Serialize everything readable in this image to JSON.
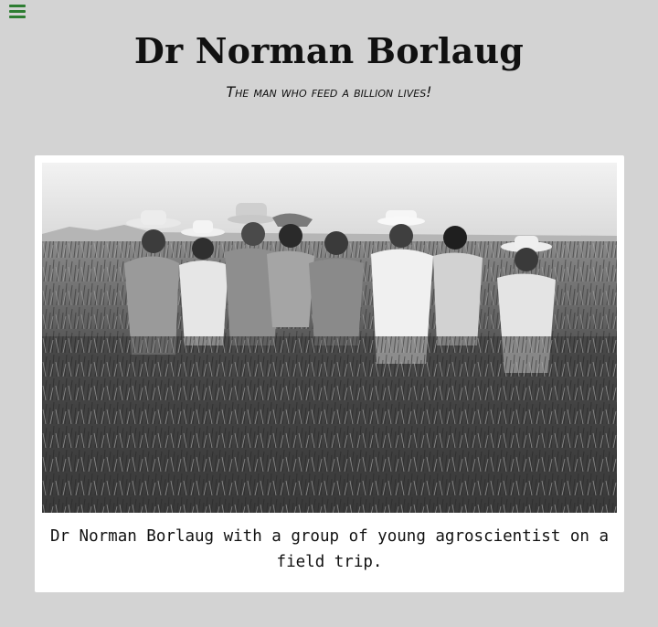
{
  "header": {
    "title": "Dr Norman Borlaug",
    "tagline": "The man who feed a billion lives!"
  },
  "nav": {
    "menu_icon": "hamburger-menu-icon",
    "accent_color": "#2e7d32"
  },
  "figure": {
    "image_alt": "Black and white photo of Dr Norman Borlaug and a group of men standing in a wheat field",
    "caption": "Dr Norman Borlaug with a group of young agroscientist on a field trip."
  }
}
